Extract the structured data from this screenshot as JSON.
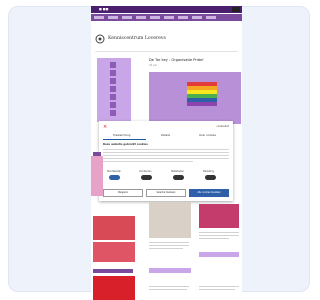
{
  "page": {
    "top_bar_text": "■ ■■",
    "site_name": "Kenniscentrum Loverevs",
    "article_headline": "De Tor key - Organisatie Pride!",
    "article_date": "23 jun",
    "sidebar_icons": [
      "home-icon",
      "search-icon",
      "share-icon",
      "print-icon",
      "phone-icon",
      "mail-icon",
      "user-icon",
      "arrow-icon"
    ]
  },
  "cookie_dialog": {
    "close_glyph": "×",
    "brand_label": "cookiebot",
    "tabs": [
      "Toestemming",
      "Details",
      "Over cookies"
    ],
    "title": "Deze website gebruikt cookies",
    "categories": [
      "Noodzakelijk",
      "Voorkeuren",
      "Statistieken",
      "Marketing"
    ],
    "buttons": [
      "Weigeren",
      "Selectie toestaan",
      "Alle cookies toestaan"
    ]
  },
  "colors": {
    "purple_dark": "#4a1f6e",
    "purple": "#7a4a9c",
    "lilac": "#c9a6e8",
    "toggle_blue": "#2f5fa8"
  }
}
